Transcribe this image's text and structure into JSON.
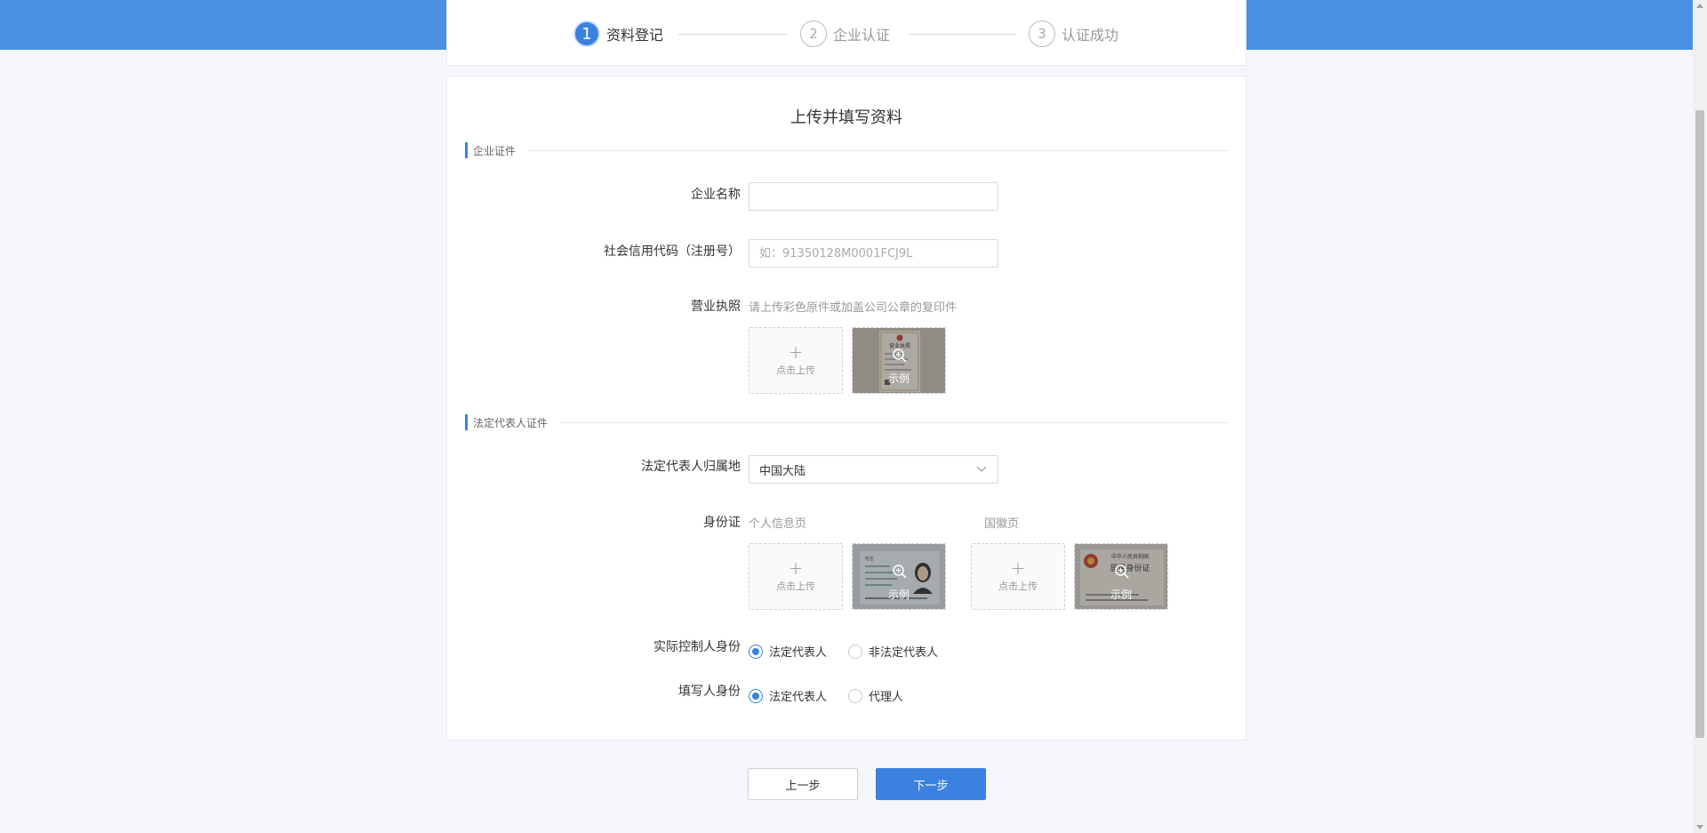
{
  "steps": [
    {
      "num": "1",
      "label": "资料登记"
    },
    {
      "num": "2",
      "label": "企业认证"
    },
    {
      "num": "3",
      "label": "认证成功"
    }
  ],
  "form": {
    "title": "上传并填写资料",
    "section_company": "企业证件",
    "section_legal": "法定代表人证件",
    "company_name": {
      "label": "企业名称",
      "value": "",
      "placeholder": ""
    },
    "credit_code": {
      "label": "社会信用代码（注册号）",
      "value": "",
      "placeholder": "如：91350128M0001FCJ9L"
    },
    "license": {
      "label": "营业执照",
      "hint": "请上传彩色原件或加盖公司公章的复印件"
    },
    "legal_region": {
      "label": "法定代表人归属地",
      "value": "中国大陆"
    },
    "id_card": {
      "label": "身份证",
      "front_label": "个人信息页",
      "back_label": "国徽页"
    },
    "controller": {
      "label": "实际控制人身份",
      "options": [
        "法定代表人",
        "非法定代表人"
      ],
      "selected": 0
    },
    "filler": {
      "label": "填写人身份",
      "options": [
        "法定代表人",
        "代理人"
      ],
      "selected": 0
    }
  },
  "upload": {
    "plus": "+",
    "text": "点击上传"
  },
  "sample_text": "示例",
  "sample_license_text": "营业执照",
  "sample_idfront_text": "姓名",
  "sample_idback_text1": "中华人民共和国",
  "sample_idback_text2": "居民身份证",
  "buttons": {
    "prev": "上一步",
    "next": "下一步"
  },
  "colors": {
    "primary": "#3b82e0",
    "band": "#4a90e2",
    "page_bg": "#f5f6f9"
  }
}
